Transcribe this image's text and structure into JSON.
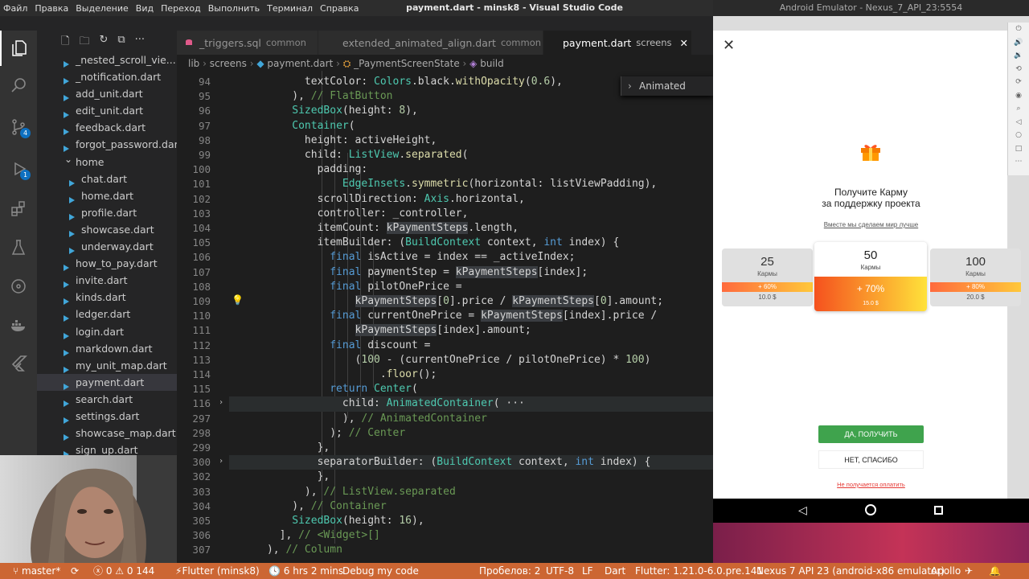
{
  "menu": [
    "Файл",
    "Правка",
    "Выделение",
    "Вид",
    "Переход",
    "Выполнить",
    "Терминал",
    "Справка"
  ],
  "vscode_title": "payment.dart - minsk8 - Visual Studio Code",
  "emulator_title": "Android Emulator - Nexus_7_API_23:5554",
  "activity": {
    "scm_badge": "4",
    "debug_badge": "1"
  },
  "explorer": {
    "items": [
      "_nested_scroll_vie...",
      "_notification.dart",
      "add_unit.dart",
      "edit_unit.dart",
      "feedback.dart",
      "forgot_password.dart",
      "home",
      "chat.dart",
      "home.dart",
      "profile.dart",
      "showcase.dart",
      "underway.dart",
      "how_to_pay.dart",
      "invite.dart",
      "kinds.dart",
      "ledger.dart",
      "login.dart",
      "markdown.dart",
      "my_unit_map.dart",
      "payment.dart",
      "search.dart",
      "settings.dart",
      "showcase_map.dart",
      "sign_up.dart"
    ]
  },
  "tabs": [
    {
      "label": "_triggers.sql",
      "desc": "common",
      "color": "#e05a8a"
    },
    {
      "label": "extended_animated_align.dart",
      "desc": "common",
      "color": "#41a6d9"
    },
    {
      "label": "payment.dart",
      "desc": "screens",
      "color": "#41a6d9"
    }
  ],
  "breadcrumb": {
    "p1": "lib",
    "p2": "screens",
    "p3": "payment.dart",
    "p4": "_PaymentScreenState",
    "p5": "build"
  },
  "find_widget": {
    "value": "Animated"
  },
  "editor": {
    "lines": [
      {
        "n": "94",
        "code": "            textColor: Colors.black.withOpacity(0.6),"
      },
      {
        "n": "95",
        "code": "          ), // FlatButton"
      },
      {
        "n": "96",
        "code": "          SizedBox(height: 8),"
      },
      {
        "n": "97",
        "code": "          Container("
      },
      {
        "n": "98",
        "code": "            height: activeHeight,"
      },
      {
        "n": "99",
        "code": "            child: ListView.separated("
      },
      {
        "n": "100",
        "code": "              padding:"
      },
      {
        "n": "101",
        "code": "                  EdgeInsets.symmetric(horizontal: listViewPadding),"
      },
      {
        "n": "102",
        "code": "              scrollDirection: Axis.horizontal,"
      },
      {
        "n": "103",
        "code": "              controller: _controller,"
      },
      {
        "n": "104",
        "code": "              itemCount: kPaymentSteps.length,"
      },
      {
        "n": "105",
        "code": "              itemBuilder: (BuildContext context, int index) {"
      },
      {
        "n": "106",
        "code": "                final isActive = index == _activeIndex;"
      },
      {
        "n": "107",
        "code": "                final paymentStep = kPaymentSteps[index];"
      },
      {
        "n": "108",
        "code": "                final pilotOnePrice ="
      },
      {
        "n": "109",
        "code": "                    kPaymentSteps[0].price / kPaymentSteps[0].amount;"
      },
      {
        "n": "110",
        "code": "                final currentOnePrice = kPaymentSteps[index].price /"
      },
      {
        "n": "111",
        "code": "                    kPaymentSteps[index].amount;"
      },
      {
        "n": "112",
        "code": "                final discount ="
      },
      {
        "n": "113",
        "code": "                    (100 - (currentOnePrice / pilotOnePrice) * 100)"
      },
      {
        "n": "114",
        "code": "                        .floor();"
      },
      {
        "n": "115",
        "code": "                return Center("
      },
      {
        "n": "116",
        "code": "                  child: AnimatedContainer( ···"
      },
      {
        "n": "297",
        "code": "                  ), // AnimatedContainer"
      },
      {
        "n": "298",
        "code": "                ); // Center"
      },
      {
        "n": "299",
        "code": "              },"
      },
      {
        "n": "300",
        "code": "              separatorBuilder: (BuildContext context, int index) {"
      },
      {
        "n": "302",
        "code": "              },"
      },
      {
        "n": "303",
        "code": "            ), // ListView.separated"
      },
      {
        "n": "304",
        "code": "          ), // Container"
      },
      {
        "n": "305",
        "code": "          SizedBox(height: 16),"
      },
      {
        "n": "306",
        "code": "        ], // <Widget>[]"
      },
      {
        "n": "307",
        "code": "      ), // Column"
      }
    ]
  },
  "status": {
    "branch": "master*",
    "problems_err": "0",
    "problems_warn": "0",
    "info": "144",
    "flutter": "Flutter (minsk8)",
    "time": "6 hrs 2 mins",
    "debug": "Debug my code",
    "spaces": "Пробелов: 2",
    "encoding": "UTF-8",
    "eol": "LF",
    "lang": "Dart",
    "flutter_ver": "Flutter: 1.21.0-6.0.pre.141",
    "device": "Nexus 7 API 23 (android-x86 emulator)",
    "apollo": "Apollo"
  },
  "app": {
    "title_line1": "Получите Карму",
    "title_line2": "за поддержку проекта",
    "subtitle": "Вместе мы сделаем мир лучше",
    "cards": [
      {
        "amount": "25",
        "unit": "Кармы",
        "discount": "+ 60%",
        "price": "10.0 $"
      },
      {
        "amount": "50",
        "unit": "Кармы",
        "discount": "+ 70%",
        "price": "15.0 $"
      },
      {
        "amount": "100",
        "unit": "Кармы",
        "discount": "+ 80%",
        "price": "20.0 $"
      }
    ],
    "yes_button": "ДА, ПОЛУЧИТЬ",
    "no_button": "НЕТ, СПАСИБО",
    "fail_link": "Не получается оплатить"
  },
  "colors": {
    "statusbar": "#cc6633",
    "green": "#3fa34d",
    "link_red": "#e53935",
    "gift": "#f57c00"
  }
}
